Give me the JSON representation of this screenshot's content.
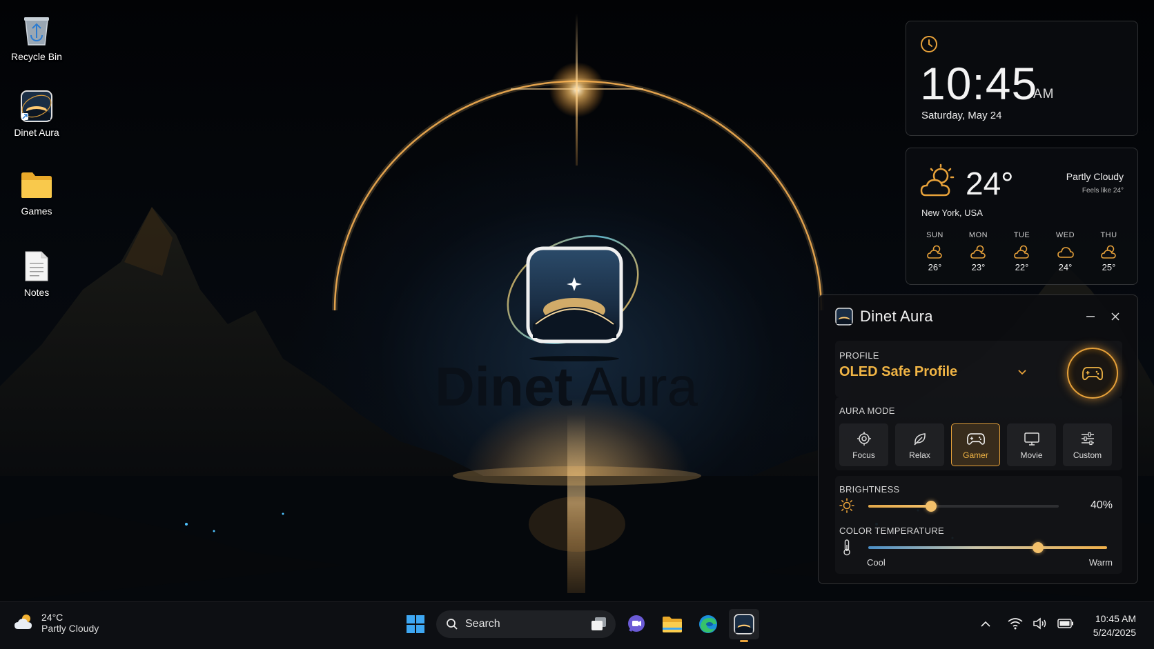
{
  "desktop": {
    "icons": [
      {
        "label": "Recycle Bin",
        "icon": "recycle-bin-icon"
      },
      {
        "label": "Dinet Aura",
        "icon": "dinet-aura-app-icon"
      },
      {
        "label": "Games",
        "icon": "folder-icon"
      },
      {
        "label": "Notes",
        "icon": "document-icon"
      }
    ]
  },
  "wallpaper": {
    "brand_word1": "Dinet",
    "brand_word2": "Aura"
  },
  "clock_widget": {
    "time": "10:45",
    "ampm": "AM",
    "date": "Saturday, May 24"
  },
  "weather_widget": {
    "temp": "24°",
    "condition": "Partly Cloudy",
    "feels_like": "Feels like 24°",
    "location": "New York, USA",
    "forecast": [
      {
        "day": "SUN",
        "temp": "26°",
        "icon": "partly-cloudy-icon"
      },
      {
        "day": "MON",
        "temp": "23°",
        "icon": "partly-cloudy-icon"
      },
      {
        "day": "TUE",
        "temp": "22°",
        "icon": "partly-cloudy-icon"
      },
      {
        "day": "WED",
        "temp": "24°",
        "icon": "cloudy-icon"
      },
      {
        "day": "THU",
        "temp": "25°",
        "icon": "partly-cloudy-icon"
      }
    ]
  },
  "aura_panel": {
    "title": "Dinet Aura",
    "profile_label": "PROFILE",
    "profile_value": "OLED Safe Profile",
    "mode_label": "AURA MODE",
    "modes": [
      {
        "label": "Focus",
        "icon": "target-icon",
        "active": false
      },
      {
        "label": "Relax",
        "icon": "leaf-icon",
        "active": false
      },
      {
        "label": "Gamer",
        "icon": "gamepad-icon",
        "active": true
      },
      {
        "label": "Movie",
        "icon": "monitor-icon",
        "active": false
      },
      {
        "label": "Custom",
        "icon": "sliders-icon",
        "active": false
      }
    ],
    "brightness_label": "BRIGHTNESS",
    "brightness_value": "40%",
    "brightness_level": 0.33,
    "color_temp_label": "COLOR TEMPERATURE",
    "color_temp_min": "Cool",
    "color_temp_max": "Warm",
    "color_temp_level": 0.71,
    "accent_color": "#E8A23A"
  },
  "taskbar": {
    "weather_temp": "24°C",
    "weather_condition": "Partly Cloudy",
    "search_label": "Search",
    "clock_time": "10:45 AM",
    "clock_date": "5/24/2025"
  }
}
